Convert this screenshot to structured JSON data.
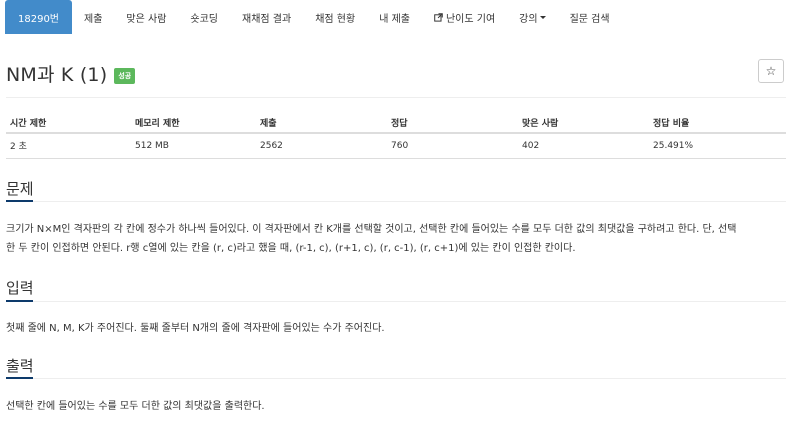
{
  "nav": {
    "items": [
      {
        "label": "18290번",
        "active": true
      },
      {
        "label": "제출"
      },
      {
        "label": "맞은 사람"
      },
      {
        "label": "숏코딩"
      },
      {
        "label": "재채점 결과"
      },
      {
        "label": "채점 현황"
      },
      {
        "label": "내 제출"
      },
      {
        "label": "난이도 기여",
        "icon": "external-link-icon"
      },
      {
        "label": "강의",
        "dropdown": true
      },
      {
        "label": "질문 검색"
      }
    ]
  },
  "problem": {
    "title": "NM과 K (1)",
    "badge": "성공",
    "star": "☆"
  },
  "info_table": {
    "headers": [
      "시간 제한",
      "메모리 제한",
      "제출",
      "정답",
      "맞은 사람",
      "정답 비율"
    ],
    "row": [
      "2 초",
      "512 MB",
      "2562",
      "760",
      "402",
      "25.491%"
    ]
  },
  "sections": {
    "description": {
      "title": "문제",
      "lines": [
        "크기가 N×M인 격자판의 각 칸에 정수가 하나씩 들어있다. 이 격자판에서 칸 K개를 선택할 것이고, 선택한 칸에 들어있는 수를 모두 더한 값의 최댓값을 구하려고 한다. 단, 선택",
        "한 두 칸이 인접하면 안된다. r행 c열에 있는 칸을 (r, c)라고 했을 때, (r-1, c), (r+1, c), (r, c-1), (r, c+1)에 있는 칸이 인접한 칸이다."
      ]
    },
    "input": {
      "title": "입력",
      "lines": [
        "첫째 줄에 N, M, K가 주어진다. 둘째 줄부터 N개의 줄에 격자판에 들어있는 수가 주어진다."
      ]
    },
    "output": {
      "title": "출력",
      "lines": [
        "선택한 칸에 들어있는 수를 모두 더한 값의 최댓값을 출력한다."
      ]
    }
  },
  "colors": {
    "nav_active": "#428bca",
    "badge_success": "#5cb85c",
    "section_underline": "#0d3a6b"
  }
}
